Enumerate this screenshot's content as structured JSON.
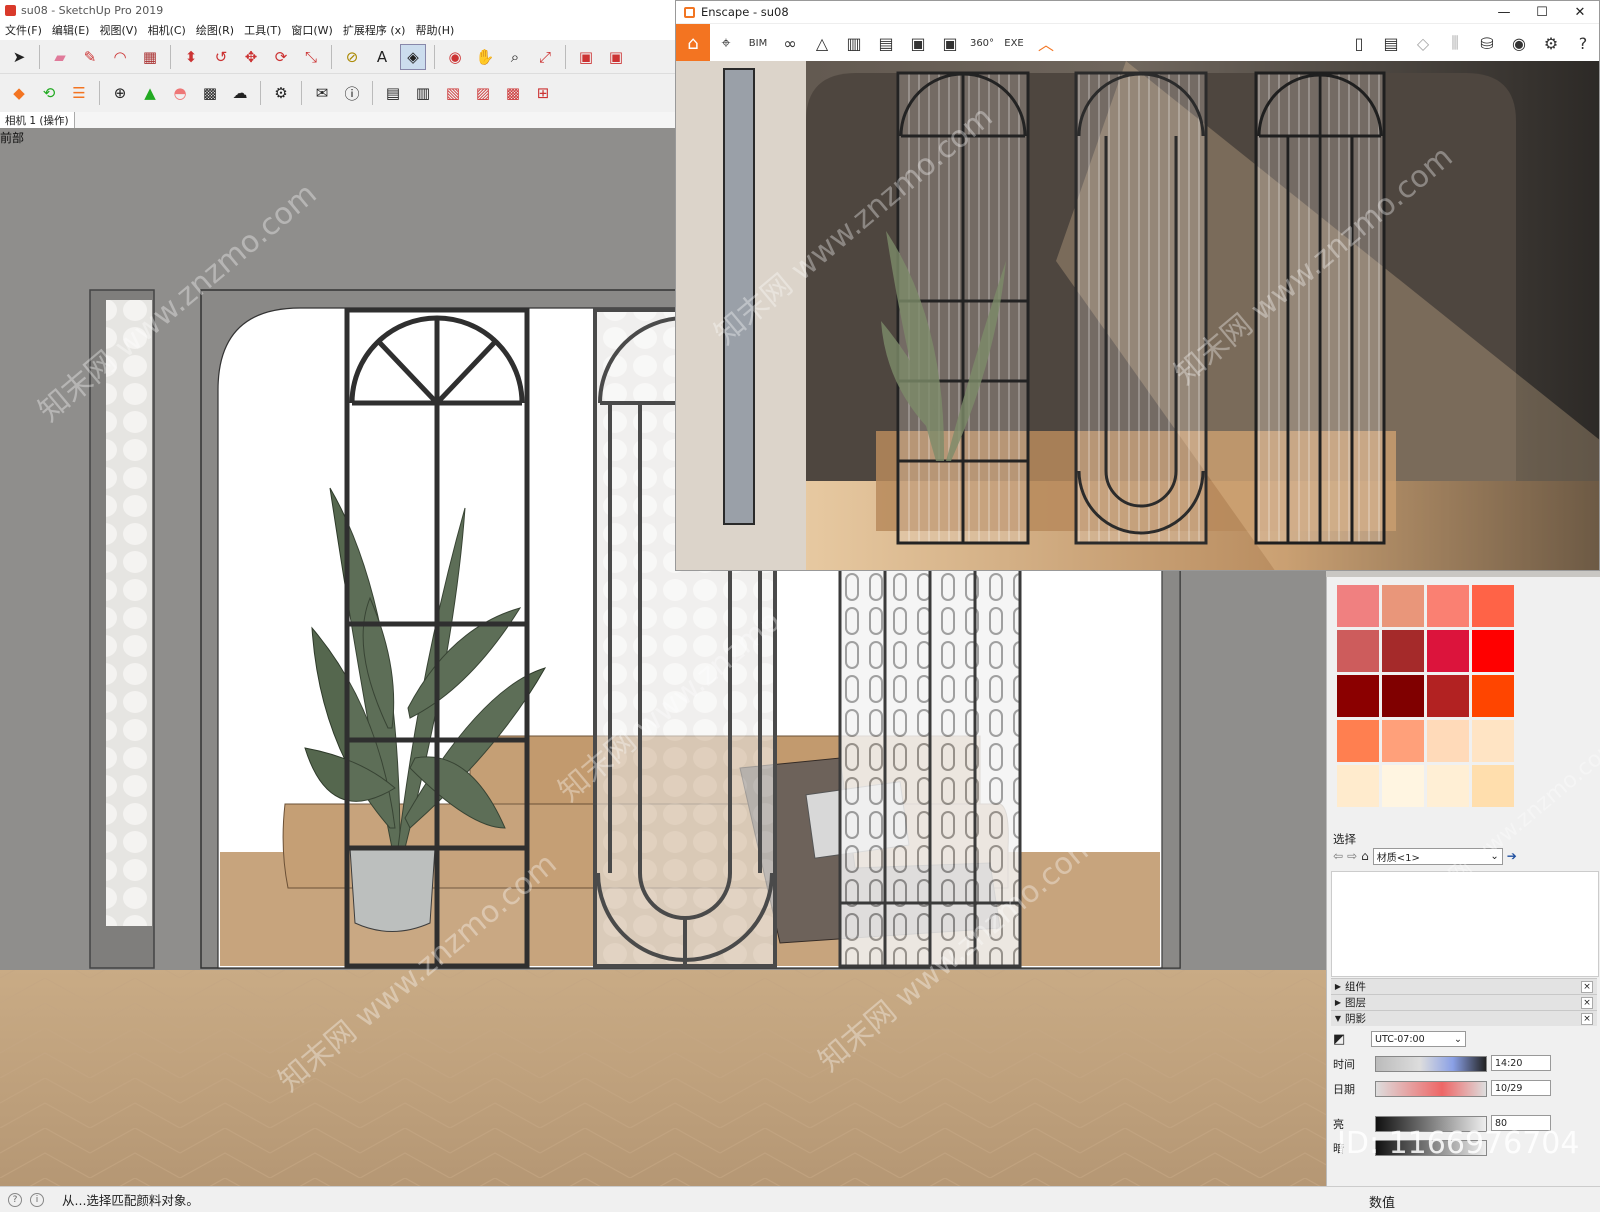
{
  "sketchup": {
    "title": "su08 - SketchUp Pro 2019",
    "menu": [
      "文件(F)",
      "编辑(E)",
      "视图(V)",
      "相机(C)",
      "绘图(R)",
      "工具(T)",
      "窗口(W)",
      "扩展程序 (x)",
      "帮助(H)"
    ],
    "scene_tab": "相机 1 (操作)",
    "viewport_label": "前部"
  },
  "enscape": {
    "title": "Enscape - su08",
    "controls": [
      "—",
      "☐",
      "✕"
    ],
    "toolbar": [
      "BIM",
      "360°",
      "EXE"
    ]
  },
  "panel": {
    "select_label": "选择",
    "material_dropdown": "材质<1>",
    "trays": [
      "组件",
      "图层",
      "阴影"
    ],
    "shadow": {
      "timezone": "UTC-07:00",
      "time_label": "时间",
      "date_label": "日期",
      "time_value": "14:20",
      "date_value": "10/29",
      "light_label": "亮",
      "light_value": "80",
      "dark_label": "暗"
    },
    "swatch_colors": [
      "#f08080",
      "#e9967a",
      "#fa8072",
      "#ff6347",
      "#cd5c5c",
      "#a52a2a",
      "#dc143c",
      "#ff0000",
      "#8b0000",
      "#800000",
      "#b22222",
      "#ff4500",
      "#ff7f50",
      "#ffa07a",
      "#ffdab9",
      "#ffe4c4",
      "#ffebcd",
      "#fff5e1",
      "#ffefd5",
      "#ffdead"
    ]
  },
  "status": {
    "text": "从...选择匹配颜料对象。",
    "measure_label": "数值"
  },
  "watermarks": [
    "知末网 www.znzmo.com",
    "ID: 1166976704"
  ]
}
